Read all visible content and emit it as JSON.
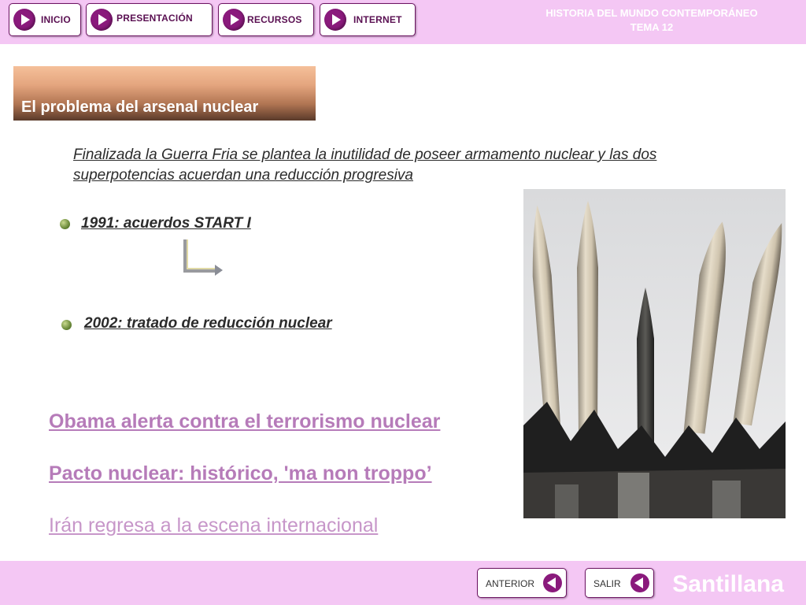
{
  "nav": {
    "inicio": "INICIO",
    "presentacion": "PRESENTACIÓN",
    "recursos": "RECURSOS",
    "internet": "INTERNET"
  },
  "header": {
    "line1": "HISTORIA DEL MUNDO CONTEMPORÁNEO",
    "line2": "TEMA 12"
  },
  "section_title": "El problema del arsenal nuclear",
  "intro": "Finalizada la Guerra Fria se plantea la inutilidad de poseer armamento nuclear y las dos superpotencias acuerdan una reducción progresiva",
  "items": [
    {
      "text": "1991: acuerdos START I"
    },
    {
      "text": "2002: tratado de reducción nuclear"
    }
  ],
  "news_links": [
    "Obama alerta contra el terrorismo nuclear",
    "Pacto nuclear: histórico, 'ma non troppo’",
    "Irán regresa a la escena internacional"
  ],
  "footer": {
    "anterior": "ANTERIOR",
    "salir": "SALIR",
    "brand": "Santillana"
  },
  "colors": {
    "bar_bg": "#f4c7f4",
    "accent": "#8a1a7c",
    "link": "#b67bb9"
  }
}
